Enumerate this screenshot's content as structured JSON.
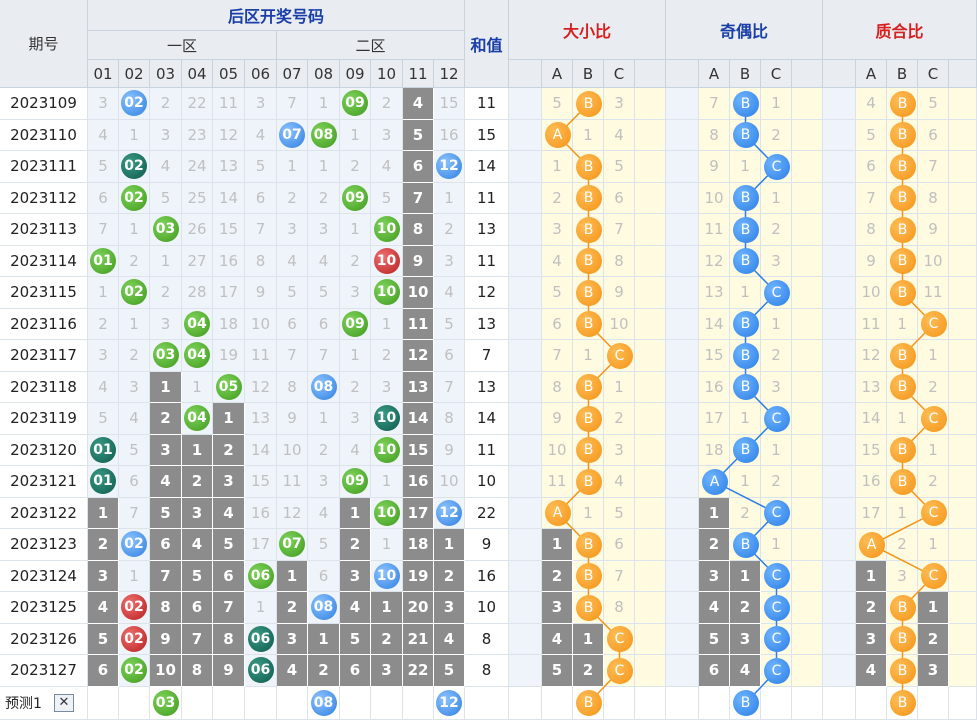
{
  "header": {
    "period": "期号",
    "title": "后区开奖号码",
    "zone1": "一区",
    "zone2": "二区",
    "sum": "和值",
    "ratio1": "大小比",
    "ratio2": "奇偶比",
    "ratio3": "质合比",
    "nums": [
      "01",
      "02",
      "03",
      "04",
      "05",
      "06",
      "07",
      "08",
      "09",
      "10",
      "11",
      "12"
    ],
    "abc": [
      "A",
      "B",
      "C"
    ]
  },
  "rows": [
    {
      "p": "2023109",
      "c": [
        [
          "3"
        ],
        [
          "02",
          "blue"
        ],
        [
          "2"
        ],
        [
          "22"
        ],
        [
          "11"
        ],
        [
          "3"
        ],
        [
          "7"
        ],
        [
          "1"
        ],
        [
          "09",
          "green"
        ],
        [
          "2"
        ],
        [
          "4",
          "g"
        ],
        [
          "15"
        ]
      ],
      "s": "11",
      "r1": [
        "5",
        [
          "B"
        ],
        "3"
      ],
      "r2": [
        "7",
        [
          "B"
        ],
        "1"
      ],
      "r3": [
        "4",
        [
          "B"
        ],
        "5"
      ]
    },
    {
      "p": "2023110",
      "c": [
        [
          "4"
        ],
        [
          "1"
        ],
        [
          "3"
        ],
        [
          "23"
        ],
        [
          "12"
        ],
        [
          "4"
        ],
        [
          "07",
          "blue"
        ],
        [
          "08",
          "green"
        ],
        [
          "1"
        ],
        [
          "3"
        ],
        [
          "5",
          "g"
        ],
        [
          "16"
        ]
      ],
      "s": "15",
      "r1": [
        [
          "A"
        ],
        "1",
        "4"
      ],
      "r2": [
        "8",
        [
          "B"
        ],
        "2"
      ],
      "r3": [
        "5",
        [
          "B"
        ],
        "6"
      ]
    },
    {
      "p": "2023111",
      "c": [
        [
          "5"
        ],
        [
          "02",
          "teal"
        ],
        [
          "4"
        ],
        [
          "24"
        ],
        [
          "13"
        ],
        [
          "5"
        ],
        [
          "1"
        ],
        [
          "1"
        ],
        [
          "2"
        ],
        [
          "4"
        ],
        [
          "6",
          "g"
        ],
        [
          "12",
          "blue"
        ]
      ],
      "s": "14",
      "r1": [
        "1",
        [
          "B"
        ],
        "5"
      ],
      "r2": [
        "9",
        "1",
        [
          "C"
        ]
      ],
      "r3": [
        "6",
        [
          "B"
        ],
        "7"
      ]
    },
    {
      "p": "2023112",
      "c": [
        [
          "6"
        ],
        [
          "02",
          "green"
        ],
        [
          "5"
        ],
        [
          "25"
        ],
        [
          "14"
        ],
        [
          "6"
        ],
        [
          "2"
        ],
        [
          "2"
        ],
        [
          "09",
          "green"
        ],
        [
          "5"
        ],
        [
          "7",
          "g"
        ],
        [
          "1"
        ]
      ],
      "s": "11",
      "r1": [
        "2",
        [
          "B"
        ],
        "6"
      ],
      "r2": [
        "10",
        [
          "B"
        ],
        "1"
      ],
      "r3": [
        "7",
        [
          "B"
        ],
        "8"
      ]
    },
    {
      "p": "2023113",
      "c": [
        [
          "7"
        ],
        [
          "1"
        ],
        [
          "03",
          "green"
        ],
        [
          "26"
        ],
        [
          "15"
        ],
        [
          "7"
        ],
        [
          "3"
        ],
        [
          "3"
        ],
        [
          "1"
        ],
        [
          "10",
          "green"
        ],
        [
          "8",
          "g"
        ],
        [
          "2"
        ]
      ],
      "s": "13",
      "r1": [
        "3",
        [
          "B"
        ],
        "7"
      ],
      "r2": [
        "11",
        [
          "B"
        ],
        "2"
      ],
      "r3": [
        "8",
        [
          "B"
        ],
        "9"
      ]
    },
    {
      "p": "2023114",
      "c": [
        [
          "01",
          "green"
        ],
        [
          "2"
        ],
        [
          "1"
        ],
        [
          "27"
        ],
        [
          "16"
        ],
        [
          "8"
        ],
        [
          "4"
        ],
        [
          "4"
        ],
        [
          "2"
        ],
        [
          "10",
          "red"
        ],
        [
          "9",
          "g"
        ],
        [
          "3"
        ]
      ],
      "s": "11",
      "r1": [
        "4",
        [
          "B"
        ],
        "8"
      ],
      "r2": [
        "12",
        [
          "B"
        ],
        "3"
      ],
      "r3": [
        "9",
        [
          "B"
        ],
        "10"
      ]
    },
    {
      "p": "2023115",
      "c": [
        [
          "1"
        ],
        [
          "02",
          "green"
        ],
        [
          "2"
        ],
        [
          "28"
        ],
        [
          "17"
        ],
        [
          "9"
        ],
        [
          "5"
        ],
        [
          "5"
        ],
        [
          "3"
        ],
        [
          "10",
          "green"
        ],
        [
          "10",
          "g"
        ],
        [
          "4"
        ]
      ],
      "s": "12",
      "r1": [
        "5",
        [
          "B"
        ],
        "9"
      ],
      "r2": [
        "13",
        "1",
        [
          "C"
        ]
      ],
      "r3": [
        "10",
        [
          "B"
        ],
        "11"
      ]
    },
    {
      "p": "2023116",
      "c": [
        [
          "2"
        ],
        [
          "1"
        ],
        [
          "3"
        ],
        [
          "04",
          "green"
        ],
        [
          "18"
        ],
        [
          "10"
        ],
        [
          "6"
        ],
        [
          "6"
        ],
        [
          "09",
          "green"
        ],
        [
          "1"
        ],
        [
          "11",
          "g"
        ],
        [
          "5"
        ]
      ],
      "s": "13",
      "r1": [
        "6",
        [
          "B"
        ],
        "10"
      ],
      "r2": [
        "14",
        [
          "B"
        ],
        "1"
      ],
      "r3": [
        "11",
        "1",
        [
          "C"
        ]
      ]
    },
    {
      "p": "2023117",
      "c": [
        [
          "3"
        ],
        [
          "2"
        ],
        [
          "03",
          "green"
        ],
        [
          "04",
          "green"
        ],
        [
          "19"
        ],
        [
          "11"
        ],
        [
          "7"
        ],
        [
          "7"
        ],
        [
          "1"
        ],
        [
          "2"
        ],
        [
          "12",
          "g"
        ],
        [
          "6"
        ]
      ],
      "s": "7",
      "r1": [
        "7",
        "1",
        [
          "C"
        ]
      ],
      "r2": [
        "15",
        [
          "B"
        ],
        "2"
      ],
      "r3": [
        "12",
        [
          "B"
        ],
        "1"
      ]
    },
    {
      "p": "2023118",
      "c": [
        [
          "4"
        ],
        [
          "3"
        ],
        [
          "1",
          "g"
        ],
        [
          "1"
        ],
        [
          "05",
          "green"
        ],
        [
          "12"
        ],
        [
          "8"
        ],
        [
          "08",
          "blue"
        ],
        [
          "2"
        ],
        [
          "3"
        ],
        [
          "13",
          "g"
        ],
        [
          "7"
        ]
      ],
      "s": "13",
      "r1": [
        "8",
        [
          "B"
        ],
        "1"
      ],
      "r2": [
        "16",
        [
          "B"
        ],
        "3"
      ],
      "r3": [
        "13",
        [
          "B"
        ],
        "2"
      ]
    },
    {
      "p": "2023119",
      "c": [
        [
          "5"
        ],
        [
          "4"
        ],
        [
          "2",
          "g"
        ],
        [
          "04",
          "green"
        ],
        [
          "1",
          "g"
        ],
        [
          "13"
        ],
        [
          "9"
        ],
        [
          "1"
        ],
        [
          "3"
        ],
        [
          "10",
          "teal"
        ],
        [
          "14",
          "g"
        ],
        [
          "8"
        ]
      ],
      "s": "14",
      "r1": [
        "9",
        [
          "B"
        ],
        "2"
      ],
      "r2": [
        "17",
        "1",
        [
          "C"
        ]
      ],
      "r3": [
        "14",
        "1",
        [
          "C"
        ]
      ]
    },
    {
      "p": "2023120",
      "c": [
        [
          "01",
          "teal"
        ],
        [
          "5"
        ],
        [
          "3",
          "g"
        ],
        [
          "1",
          "g"
        ],
        [
          "2",
          "g"
        ],
        [
          "14"
        ],
        [
          "10"
        ],
        [
          "2"
        ],
        [
          "4"
        ],
        [
          "10",
          "green"
        ],
        [
          "15",
          "g"
        ],
        [
          "9"
        ]
      ],
      "s": "11",
      "r1": [
        "10",
        [
          "B"
        ],
        "3"
      ],
      "r2": [
        "18",
        [
          "B"
        ],
        "1"
      ],
      "r3": [
        "15",
        [
          "B"
        ],
        "1"
      ]
    },
    {
      "p": "2023121",
      "c": [
        [
          "01",
          "teal"
        ],
        [
          "6"
        ],
        [
          "4",
          "g"
        ],
        [
          "2",
          "g"
        ],
        [
          "3",
          "g"
        ],
        [
          "15"
        ],
        [
          "11"
        ],
        [
          "3"
        ],
        [
          "09",
          "green"
        ],
        [
          "1"
        ],
        [
          "16",
          "g"
        ],
        [
          "10"
        ]
      ],
      "s": "10",
      "r1": [
        "11",
        [
          "B"
        ],
        "4"
      ],
      "r2": [
        [
          "A"
        ],
        "1",
        "2"
      ],
      "r3": [
        "16",
        [
          "B"
        ],
        "2"
      ]
    },
    {
      "p": "2023122",
      "c": [
        [
          "1",
          "g"
        ],
        [
          "7"
        ],
        [
          "5",
          "g"
        ],
        [
          "3",
          "g"
        ],
        [
          "4",
          "g"
        ],
        [
          "16"
        ],
        [
          "12"
        ],
        [
          "4"
        ],
        [
          "1",
          "g"
        ],
        [
          "10",
          "green"
        ],
        [
          "17",
          "g"
        ],
        [
          "12",
          "blue"
        ]
      ],
      "s": "22",
      "r1": [
        [
          "A"
        ],
        "1",
        "5"
      ],
      "r2": [
        "1",
        "2",
        [
          "C"
        ]
      ],
      "r3": [
        "17",
        "1",
        [
          "C"
        ]
      ]
    },
    {
      "p": "2023123",
      "c": [
        [
          "2",
          "g"
        ],
        [
          "02",
          "blue"
        ],
        [
          "6",
          "g"
        ],
        [
          "4",
          "g"
        ],
        [
          "5",
          "g"
        ],
        [
          "17"
        ],
        [
          "07",
          "green"
        ],
        [
          "5"
        ],
        [
          "2",
          "g"
        ],
        [
          "1"
        ],
        [
          "18",
          "g"
        ],
        [
          "1",
          "g"
        ]
      ],
      "s": "9",
      "r1": [
        "1",
        [
          "B"
        ],
        "6"
      ],
      "r2": [
        "2",
        [
          "B"
        ],
        "1"
      ],
      "r3": [
        [
          "A"
        ],
        "2",
        "1"
      ]
    },
    {
      "p": "2023124",
      "c": [
        [
          "3",
          "g"
        ],
        [
          "1"
        ],
        [
          "7",
          "g"
        ],
        [
          "5",
          "g"
        ],
        [
          "6",
          "g"
        ],
        [
          "06",
          "green"
        ],
        [
          "1",
          "g"
        ],
        [
          "6"
        ],
        [
          "3",
          "g"
        ],
        [
          "10",
          "blue"
        ],
        [
          "19",
          "g"
        ],
        [
          "2",
          "g"
        ]
      ],
      "s": "16",
      "r1": [
        "2",
        [
          "B"
        ],
        "7"
      ],
      "r2": [
        "3",
        "1",
        [
          "C"
        ]
      ],
      "r3": [
        "1",
        "3",
        [
          "C"
        ]
      ]
    },
    {
      "p": "2023125",
      "c": [
        [
          "4",
          "g"
        ],
        [
          "02",
          "red"
        ],
        [
          "8",
          "g"
        ],
        [
          "6",
          "g"
        ],
        [
          "7",
          "g"
        ],
        [
          "1"
        ],
        [
          "2",
          "g"
        ],
        [
          "08",
          "blue"
        ],
        [
          "4",
          "g"
        ],
        [
          "1",
          "g"
        ],
        [
          "20",
          "g"
        ],
        [
          "3",
          "g"
        ]
      ],
      "s": "10",
      "r1": [
        "3",
        [
          "B"
        ],
        "8"
      ],
      "r2": [
        "4",
        "2",
        [
          "C"
        ]
      ],
      "r3": [
        "2",
        [
          "B"
        ],
        "1"
      ]
    },
    {
      "p": "2023126",
      "c": [
        [
          "5",
          "g"
        ],
        [
          "02",
          "red"
        ],
        [
          "9",
          "g"
        ],
        [
          "7",
          "g"
        ],
        [
          "8",
          "g"
        ],
        [
          "06",
          "teal"
        ],
        [
          "3",
          "g"
        ],
        [
          "1",
          "g"
        ],
        [
          "5",
          "g"
        ],
        [
          "2",
          "g"
        ],
        [
          "21",
          "g"
        ],
        [
          "4",
          "g"
        ]
      ],
      "s": "8",
      "r1": [
        "4",
        "1",
        [
          "C"
        ]
      ],
      "r2": [
        "5",
        "3",
        [
          "C"
        ]
      ],
      "r3": [
        "3",
        [
          "B"
        ],
        "2"
      ]
    },
    {
      "p": "2023127",
      "c": [
        [
          "6",
          "g"
        ],
        [
          "02",
          "green"
        ],
        [
          "10",
          "g"
        ],
        [
          "8",
          "g"
        ],
        [
          "9",
          "g"
        ],
        [
          "06",
          "teal"
        ],
        [
          "4",
          "g"
        ],
        [
          "2",
          "g"
        ],
        [
          "6",
          "g"
        ],
        [
          "3",
          "g"
        ],
        [
          "22",
          "g"
        ],
        [
          "5",
          "g"
        ]
      ],
      "s": "8",
      "r1": [
        "5",
        "2",
        [
          "C"
        ]
      ],
      "r2": [
        "6",
        "4",
        [
          "C"
        ]
      ],
      "r3": [
        "4",
        [
          "B"
        ],
        "3"
      ]
    }
  ],
  "predict": {
    "label": "预测1",
    "close": "✕",
    "balls": [
      [
        "",
        ""
      ],
      [
        "",
        ""
      ],
      [
        "03",
        "green"
      ],
      [
        "",
        ""
      ],
      [
        "",
        ""
      ],
      [
        "",
        ""
      ],
      [
        "",
        ""
      ],
      [
        "08",
        "blue"
      ],
      [
        "",
        ""
      ],
      [
        "",
        ""
      ],
      [
        "",
        ""
      ],
      [
        "12",
        "blue"
      ]
    ],
    "r1": [
      "",
      "B",
      ""
    ],
    "r2": [
      "",
      "B",
      ""
    ],
    "r3": [
      "",
      "B",
      ""
    ]
  },
  "colors": {
    "orange": "#f39317",
    "blue": "#2a7ee5",
    "gray": "#8c8c8c",
    "bgLight": "#eef4fa",
    "bgYellow": "#fffbe0"
  }
}
